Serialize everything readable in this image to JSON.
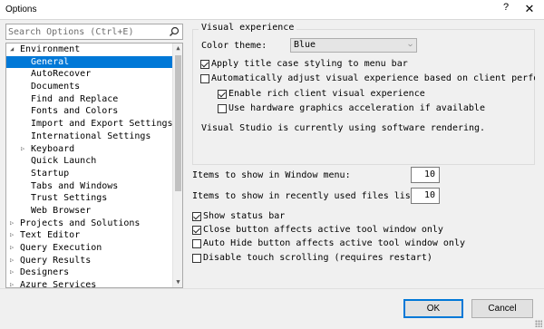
{
  "window": {
    "title": "Options",
    "help_glyph": "?",
    "close_glyph": "✕"
  },
  "search": {
    "placeholder": "Search Options (Ctrl+E)",
    "icon": "search-icon"
  },
  "tree": {
    "items": [
      {
        "label": "Environment",
        "arrow": "◢",
        "level": 0
      },
      {
        "label": "General",
        "arrow": "",
        "level": 1,
        "selected": true
      },
      {
        "label": "AutoRecover",
        "arrow": "",
        "level": 1
      },
      {
        "label": "Documents",
        "arrow": "",
        "level": 1
      },
      {
        "label": "Find and Replace",
        "arrow": "",
        "level": 1
      },
      {
        "label": "Fonts and Colors",
        "arrow": "",
        "level": 1
      },
      {
        "label": "Import and Export Settings",
        "arrow": "",
        "level": 1
      },
      {
        "label": "International Settings",
        "arrow": "",
        "level": 1
      },
      {
        "label": "Keyboard",
        "arrow": "▷",
        "level": 1
      },
      {
        "label": "Quick Launch",
        "arrow": "",
        "level": 1
      },
      {
        "label": "Startup",
        "arrow": "",
        "level": 1
      },
      {
        "label": "Tabs and Windows",
        "arrow": "",
        "level": 1
      },
      {
        "label": "Trust Settings",
        "arrow": "",
        "level": 1
      },
      {
        "label": "Web Browser",
        "arrow": "",
        "level": 1
      },
      {
        "label": "Projects and Solutions",
        "arrow": "▷",
        "level": 0
      },
      {
        "label": "Text Editor",
        "arrow": "▷",
        "level": 0
      },
      {
        "label": "Query Execution",
        "arrow": "▷",
        "level": 0
      },
      {
        "label": "Query Results",
        "arrow": "▷",
        "level": 0
      },
      {
        "label": "Designers",
        "arrow": "▷",
        "level": 0
      },
      {
        "label": "Azure Services",
        "arrow": "▷",
        "level": 0
      }
    ]
  },
  "visual_experience": {
    "legend": "Visual experience",
    "color_theme_label": "Color theme:",
    "color_theme_value": "Blue",
    "apply_title_case": {
      "label": "Apply title case styling to menu bar",
      "checked": true
    },
    "auto_adjust": {
      "label": "Automatically adjust visual experience based on client performance",
      "checked": false
    },
    "rich_client": {
      "label": "Enable rich client visual experience",
      "checked": true
    },
    "hw_accel": {
      "label": "Use hardware graphics acceleration if available",
      "checked": false
    },
    "status_text": "Visual Studio is currently using software rendering."
  },
  "items": {
    "window_menu_label": "Items to show in Window menu:",
    "window_menu_value": "10",
    "recent_files_label": "Items to show in recently used files list:",
    "recent_files_value": "10"
  },
  "options": {
    "show_status_bar": {
      "label": "Show status bar",
      "checked": true
    },
    "close_button": {
      "label": "Close button affects active tool window only",
      "checked": true
    },
    "auto_hide": {
      "label": "Auto Hide button affects active tool window only",
      "checked": false
    },
    "disable_touch": {
      "label": "Disable touch scrolling (requires restart)",
      "checked": false
    }
  },
  "buttons": {
    "ok": "OK",
    "cancel": "Cancel"
  }
}
